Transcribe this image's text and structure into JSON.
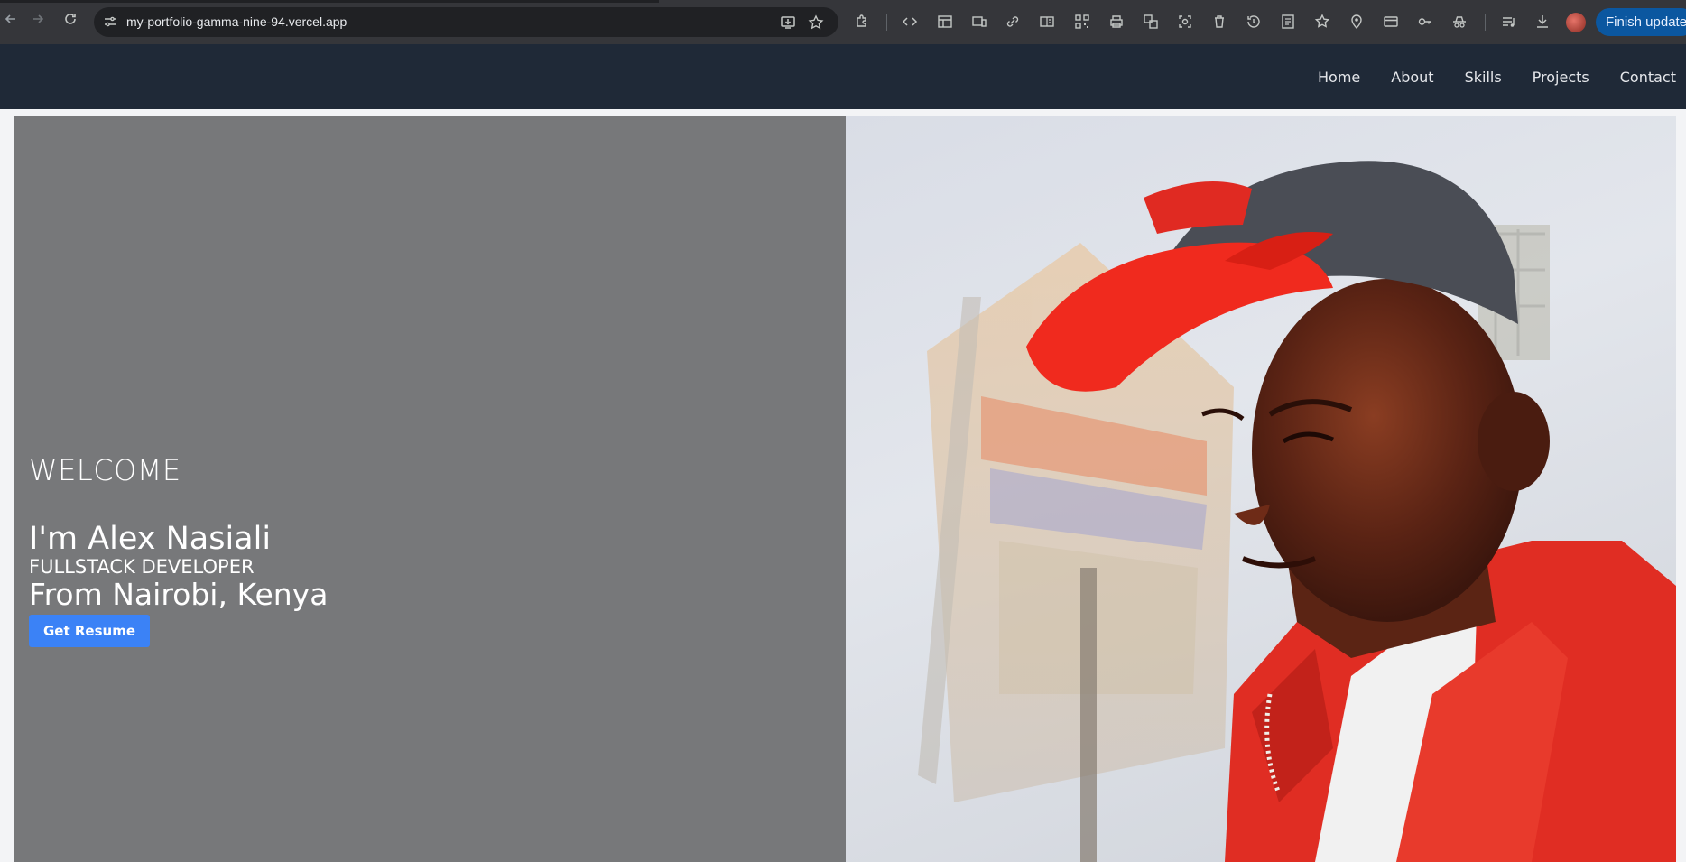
{
  "browser": {
    "url": "my-portfolio-gamma-nine-94.vercel.app",
    "update_button": "Finish update"
  },
  "nav": {
    "items": [
      "Home",
      "About",
      "Skills",
      "Projects",
      "Contact"
    ]
  },
  "hero": {
    "welcome": "WELCOME",
    "name": "I'm Alex Nasiali",
    "role": "FULLSTACK DEVELOPER",
    "location": "From Nairobi, Kenya",
    "resume_button": "Get Resume"
  },
  "colors": {
    "header_bg": "#1f2937",
    "hero_left_bg": "#77787a",
    "button_blue": "#3b82f6"
  }
}
